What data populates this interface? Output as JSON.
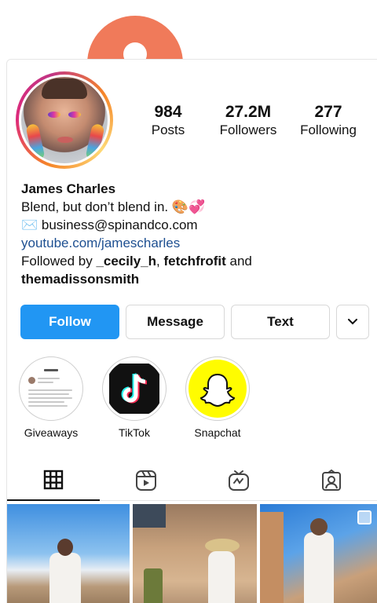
{
  "profile": {
    "stats": [
      {
        "num": "984",
        "label": "Posts"
      },
      {
        "num": "27.2M",
        "label": "Followers"
      },
      {
        "num": "277",
        "label": "Following"
      }
    ],
    "name": "James Charles",
    "bio_line": "Blend, but don’t blend in. 🎨💞",
    "email_line": "✉️ business@spinandco.com",
    "link": "youtube.com/jamescharles",
    "followed_prefix": "Followed by ",
    "followed_user1": "_cecily_h",
    "followed_sep": ", ",
    "followed_user2": "fetchfrofit",
    "followed_and": " and",
    "followed_user3": "themadissonsmith"
  },
  "buttons": {
    "follow": "Follow",
    "message": "Message",
    "text": "Text",
    "more_icon": "chevron-down-icon"
  },
  "highlights": [
    {
      "label": "Giveaways",
      "icon": "tweet-screenshot"
    },
    {
      "label": "TikTok",
      "icon": "tiktok-icon"
    },
    {
      "label": "Snapchat",
      "icon": "snapchat-icon"
    }
  ],
  "tabs": [
    "grid-icon",
    "reels-icon",
    "igtv-icon",
    "tagged-icon"
  ],
  "colors": {
    "follow_button": "#2196F3",
    "link": "#1d4f91",
    "story_ring": "#DD2A7B",
    "snapchat": "#FFFC00",
    "background_accent": "#F07A5A"
  }
}
